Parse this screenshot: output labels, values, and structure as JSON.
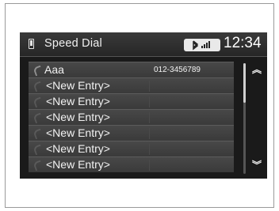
{
  "header": {
    "title": "Speed Dial",
    "status": "Bluetooth & signal",
    "clock": "12:34"
  },
  "entries": [
    {
      "name": "Aaa",
      "number": "012-3456789"
    },
    {
      "name": "<New Entry>",
      "number": ""
    },
    {
      "name": "<New Entry>",
      "number": ""
    },
    {
      "name": "<New Entry>",
      "number": ""
    },
    {
      "name": "<New Entry>",
      "number": ""
    },
    {
      "name": "<New Entry>",
      "number": ""
    },
    {
      "name": "<New Entry>",
      "number": ""
    }
  ],
  "scroll": {
    "up": "︽",
    "down": "︾"
  }
}
